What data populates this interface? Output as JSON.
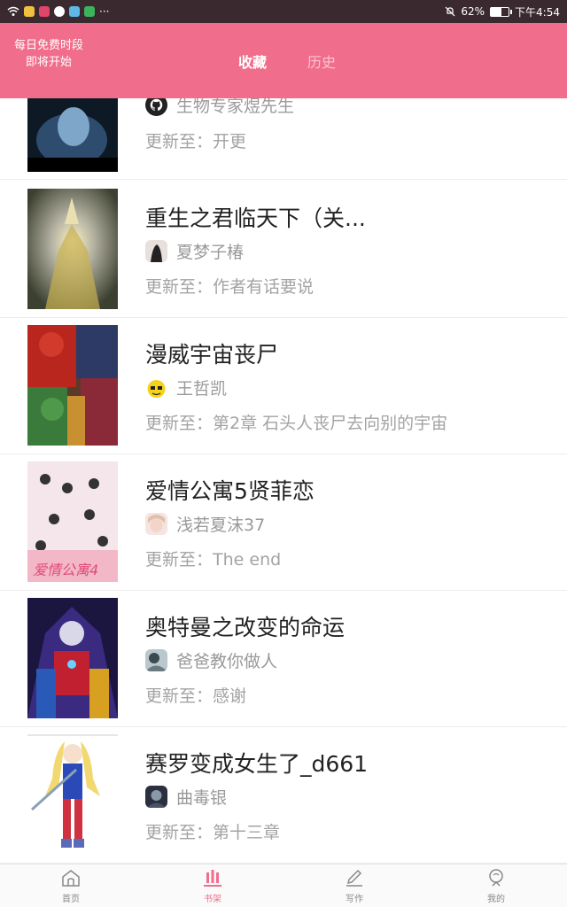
{
  "status_bar": {
    "battery": "62%",
    "time": "下午4:54",
    "battery_level": 0.62
  },
  "header": {
    "free_slot_line1": "每日免费时段",
    "free_slot_line2": "即将开始",
    "tabs": [
      {
        "label": "收藏",
        "active": true
      },
      {
        "label": "历史",
        "active": false
      }
    ],
    "accent_color": "#f06e8c"
  },
  "list": {
    "update_prefix": "更新至：",
    "items": [
      {
        "title": "",
        "author": "生物专家煜先生",
        "update": "开更",
        "author_icon": "github-icon"
      },
      {
        "title": "重生之君临天下（关...",
        "author": "夏梦子椿",
        "update": "作者有话要说",
        "author_icon": "avatar-icon"
      },
      {
        "title": "漫威宇宙丧尸",
        "author": "王哲凯",
        "update": "第2章 石头人丧尸去向别的宇宙",
        "author_icon": "avatar-icon"
      },
      {
        "title": "爱情公寓5贤菲恋",
        "author": "浅若夏沫37",
        "update": "The end",
        "author_icon": "avatar-icon"
      },
      {
        "title": "奥特曼之改变的命运",
        "author": "爸爸教你做人",
        "update": "感谢",
        "author_icon": "avatar-icon"
      },
      {
        "title": "赛罗变成女生了_d661",
        "author": "曲毒银",
        "update": "第十三章",
        "author_icon": "avatar-icon"
      }
    ]
  },
  "bottom_nav": [
    {
      "label": "首页",
      "icon": "home-icon",
      "active": false
    },
    {
      "label": "书架",
      "icon": "bookshelf-icon",
      "active": true
    },
    {
      "label": "写作",
      "icon": "pen-icon",
      "active": false
    },
    {
      "label": "我的",
      "icon": "profile-icon",
      "active": false
    }
  ]
}
